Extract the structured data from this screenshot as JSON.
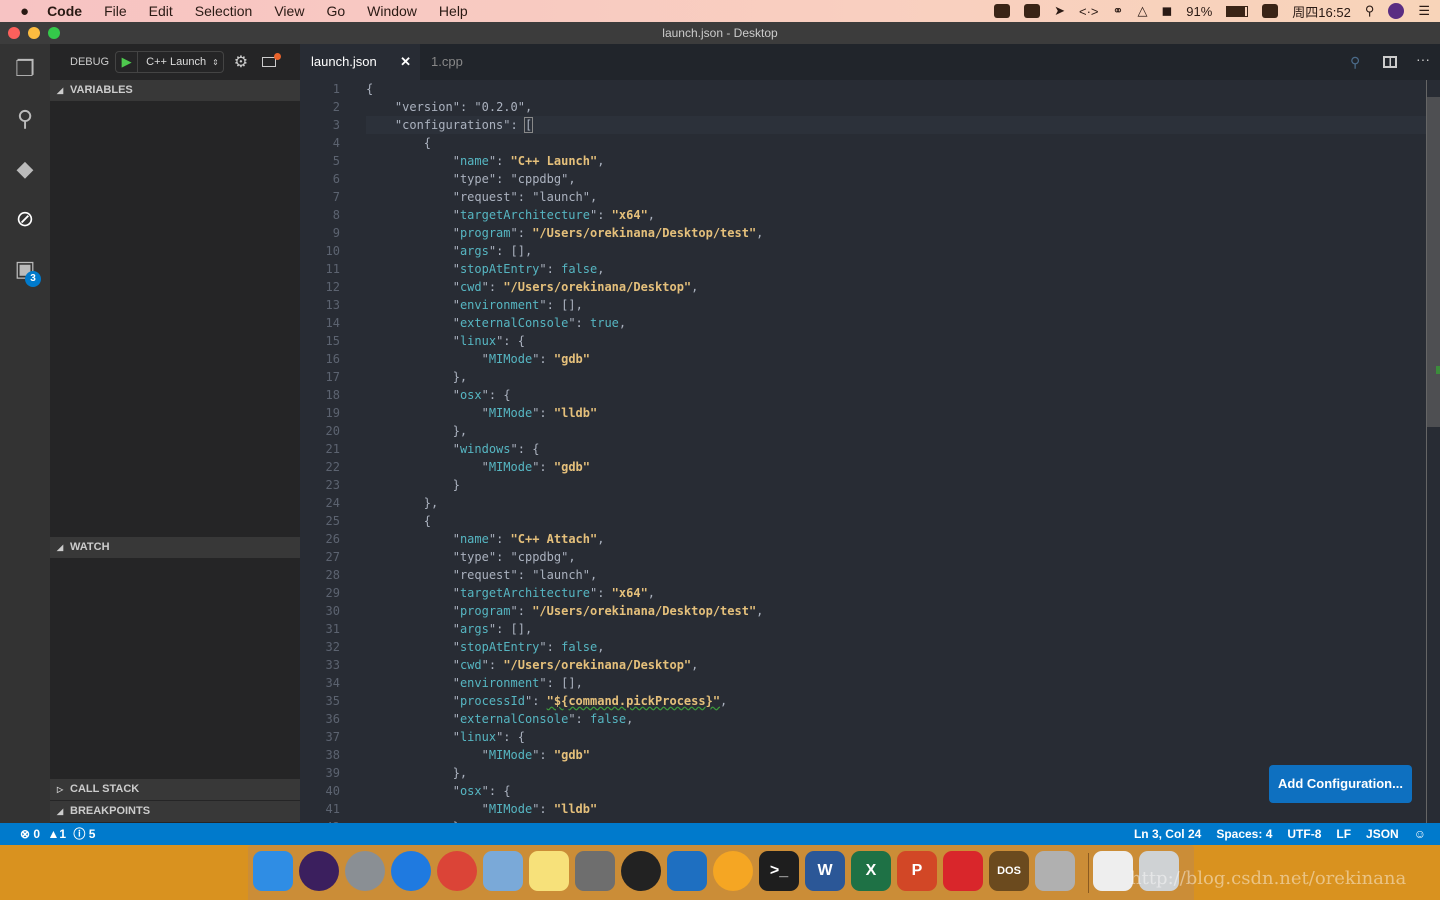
{
  "menubar": {
    "app": "Code",
    "items": [
      "File",
      "Edit",
      "Selection",
      "View",
      "Go",
      "Window",
      "Help"
    ],
    "battery": "91%",
    "clock": "周四16:52"
  },
  "window": {
    "title": "launch.json - Desktop"
  },
  "activity": {
    "extensions_badge": "3"
  },
  "debug": {
    "label": "DEBUG",
    "config": "C++ Launch"
  },
  "sidebar": {
    "sections": [
      "VARIABLES",
      "WATCH",
      "CALL STACK",
      "BREAKPOINTS"
    ]
  },
  "tabs": [
    {
      "label": "launch.json",
      "active": true
    },
    {
      "label": "1.cpp",
      "active": false
    }
  ],
  "editor": {
    "cursor_line": 3,
    "lines": [
      {
        "i": 0,
        "p": "{"
      },
      {
        "i": 1,
        "k": "version",
        "kc": "g",
        "v": "\"0.2.0\"",
        "vc": "g",
        "t": ","
      },
      {
        "i": 1,
        "k": "configurations",
        "kc": "g",
        "v": "[",
        "vc": "g",
        "t": ""
      },
      {
        "i": 2,
        "p": "{"
      },
      {
        "i": 3,
        "k": "name",
        "kc": "c",
        "v": "\"C++ Launch\"",
        "vc": "s",
        "t": ","
      },
      {
        "i": 3,
        "k": "type",
        "kc": "g",
        "v": "\"cppdbg\"",
        "vc": "g",
        "t": ","
      },
      {
        "i": 3,
        "k": "request",
        "kc": "g",
        "v": "\"launch\"",
        "vc": "g",
        "t": ","
      },
      {
        "i": 3,
        "k": "targetArchitecture",
        "kc": "c",
        "v": "\"x64\"",
        "vc": "s",
        "t": ","
      },
      {
        "i": 3,
        "k": "program",
        "kc": "c",
        "v": "\"/Users/orekinana/Desktop/test\"",
        "vc": "s",
        "t": ","
      },
      {
        "i": 3,
        "k": "args",
        "kc": "c",
        "v": "[]",
        "vc": "g",
        "t": ","
      },
      {
        "i": 3,
        "k": "stopAtEntry",
        "kc": "c",
        "v": "false",
        "vc": "b",
        "t": ","
      },
      {
        "i": 3,
        "k": "cwd",
        "kc": "c",
        "v": "\"/Users/orekinana/Desktop\"",
        "vc": "s",
        "t": ","
      },
      {
        "i": 3,
        "k": "environment",
        "kc": "c",
        "v": "[]",
        "vc": "g",
        "t": ","
      },
      {
        "i": 3,
        "k": "externalConsole",
        "kc": "c",
        "v": "true",
        "vc": "b",
        "t": ","
      },
      {
        "i": 3,
        "k": "linux",
        "kc": "c",
        "v": "{",
        "vc": "g",
        "t": ""
      },
      {
        "i": 4,
        "k": "MIMode",
        "kc": "c",
        "v": "\"gdb\"",
        "vc": "s",
        "t": ""
      },
      {
        "i": 3,
        "p": "},"
      },
      {
        "i": 3,
        "k": "osx",
        "kc": "c",
        "v": "{",
        "vc": "g",
        "t": ""
      },
      {
        "i": 4,
        "k": "MIMode",
        "kc": "c",
        "v": "\"lldb\"",
        "vc": "s",
        "t": ""
      },
      {
        "i": 3,
        "p": "},"
      },
      {
        "i": 3,
        "k": "windows",
        "kc": "c",
        "v": "{",
        "vc": "g",
        "t": ""
      },
      {
        "i": 4,
        "k": "MIMode",
        "kc": "c",
        "v": "\"gdb\"",
        "vc": "s",
        "t": ""
      },
      {
        "i": 3,
        "p": "}"
      },
      {
        "i": 2,
        "p": "},"
      },
      {
        "i": 2,
        "p": "{"
      },
      {
        "i": 3,
        "k": "name",
        "kc": "c",
        "v": "\"C++ Attach\"",
        "vc": "s",
        "t": ","
      },
      {
        "i": 3,
        "k": "type",
        "kc": "g",
        "v": "\"cppdbg\"",
        "vc": "g",
        "t": ","
      },
      {
        "i": 3,
        "k": "request",
        "kc": "g",
        "v": "\"launch\"",
        "vc": "g",
        "t": ","
      },
      {
        "i": 3,
        "k": "targetArchitecture",
        "kc": "c",
        "v": "\"x64\"",
        "vc": "s",
        "t": ","
      },
      {
        "i": 3,
        "k": "program",
        "kc": "c",
        "v": "\"/Users/orekinana/Desktop/test\"",
        "vc": "s",
        "t": ","
      },
      {
        "i": 3,
        "k": "args",
        "kc": "c",
        "v": "[]",
        "vc": "g",
        "t": ","
      },
      {
        "i": 3,
        "k": "stopAtEntry",
        "kc": "c",
        "v": "false",
        "vc": "b",
        "t": ","
      },
      {
        "i": 3,
        "k": "cwd",
        "kc": "c",
        "v": "\"/Users/orekinana/Desktop\"",
        "vc": "s",
        "t": ","
      },
      {
        "i": 3,
        "k": "environment",
        "kc": "c",
        "v": "[]",
        "vc": "g",
        "t": ","
      },
      {
        "i": 3,
        "k": "processId",
        "kc": "c",
        "v": "\"${command.pickProcess}\"",
        "vc": "s",
        "t": ",",
        "warn": true
      },
      {
        "i": 3,
        "k": "externalConsole",
        "kc": "c",
        "v": "false",
        "vc": "b",
        "t": ","
      },
      {
        "i": 3,
        "k": "linux",
        "kc": "c",
        "v": "{",
        "vc": "g",
        "t": ""
      },
      {
        "i": 4,
        "k": "MIMode",
        "kc": "c",
        "v": "\"gdb\"",
        "vc": "s",
        "t": ""
      },
      {
        "i": 3,
        "p": "},"
      },
      {
        "i": 3,
        "k": "osx",
        "kc": "c",
        "v": "{",
        "vc": "g",
        "t": ""
      },
      {
        "i": 4,
        "k": "MIMode",
        "kc": "c",
        "v": "\"lldb\"",
        "vc": "s",
        "t": ""
      },
      {
        "i": 3,
        "p": "},"
      }
    ]
  },
  "add_configuration": "Add Configuration...",
  "status": {
    "errors": "0",
    "warnings": "1",
    "infos": "5",
    "position": "Ln 3, Col 24",
    "spaces": "Spaces: 4",
    "encoding": "UTF-8",
    "eol": "LF",
    "language": "JSON"
  },
  "dock": [
    {
      "name": "finder",
      "color": "#2f8de4",
      "glyph": ""
    },
    {
      "name": "siri",
      "color": "#3b1f5e",
      "glyph": ""
    },
    {
      "name": "launchpad",
      "color": "#8a8f94",
      "glyph": ""
    },
    {
      "name": "safari",
      "color": "#1f7ae0",
      "glyph": ""
    },
    {
      "name": "chrome",
      "color": "#db4437",
      "glyph": ""
    },
    {
      "name": "mail",
      "color": "#7aa9d8",
      "glyph": ""
    },
    {
      "name": "notes",
      "color": "#f7e17a",
      "glyph": ""
    },
    {
      "name": "system-preferences",
      "color": "#6e6e6e",
      "glyph": ""
    },
    {
      "name": "qq",
      "color": "#222",
      "glyph": ""
    },
    {
      "name": "vscode",
      "color": "#1e6fc1",
      "glyph": ""
    },
    {
      "name": "infuse",
      "color": "#f5a623",
      "glyph": ""
    },
    {
      "name": "terminal",
      "color": "#1e1e1e",
      "glyph": ">_"
    },
    {
      "name": "word",
      "color": "#2b5797",
      "glyph": "W"
    },
    {
      "name": "excel",
      "color": "#1e7145",
      "glyph": "X"
    },
    {
      "name": "powerpoint",
      "color": "#d24726",
      "glyph": "P"
    },
    {
      "name": "parallels",
      "color": "#d9262b",
      "glyph": ""
    },
    {
      "name": "dosbox",
      "color": "#6b4a1e",
      "glyph": "DOS"
    },
    {
      "name": "keychain",
      "color": "#b0b0b0",
      "glyph": ""
    },
    {
      "name": "documents",
      "color": "#eeeeee",
      "glyph": ""
    },
    {
      "name": "trash",
      "color": "#cfd2d4",
      "glyph": ""
    }
  ],
  "watermark": "http://blog.csdn.net/orekinana"
}
